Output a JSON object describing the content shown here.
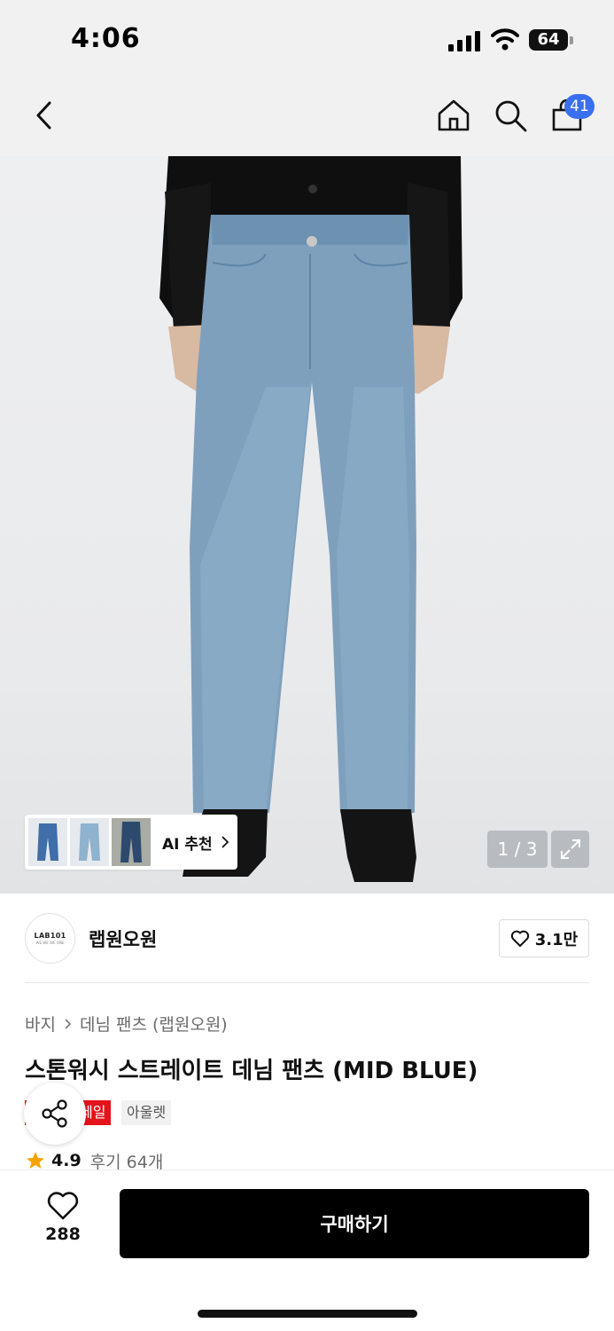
{
  "status_bar": {
    "time": "4:06",
    "battery": "64"
  },
  "nav": {
    "cart_count": "41"
  },
  "gallery": {
    "counter": "1 / 3",
    "ai_label": "AI 추천"
  },
  "brand": {
    "logo_line1": "LAB101",
    "logo_line2": "WE WE WE ONE",
    "name": "랩원오원",
    "likes": "3.1만"
  },
  "breadcrumb": {
    "category": "바지",
    "subcategory": "데님 팬츠 (랩원오원)"
  },
  "product": {
    "title": "스톤워시 스트레이트 데님 팬츠 (MID BLUE)",
    "tag_sale": "세일",
    "tag_outlet": "아울렛",
    "rating": "4.9",
    "review_label": "후기 64개"
  },
  "bottom": {
    "wish_count": "288",
    "buy_label": "구매하기"
  },
  "colors": {
    "accent_blue": "#3a6ff0",
    "sale_red": "#e3141b",
    "star": "#f5a300",
    "denim": "#7ea0bd"
  }
}
